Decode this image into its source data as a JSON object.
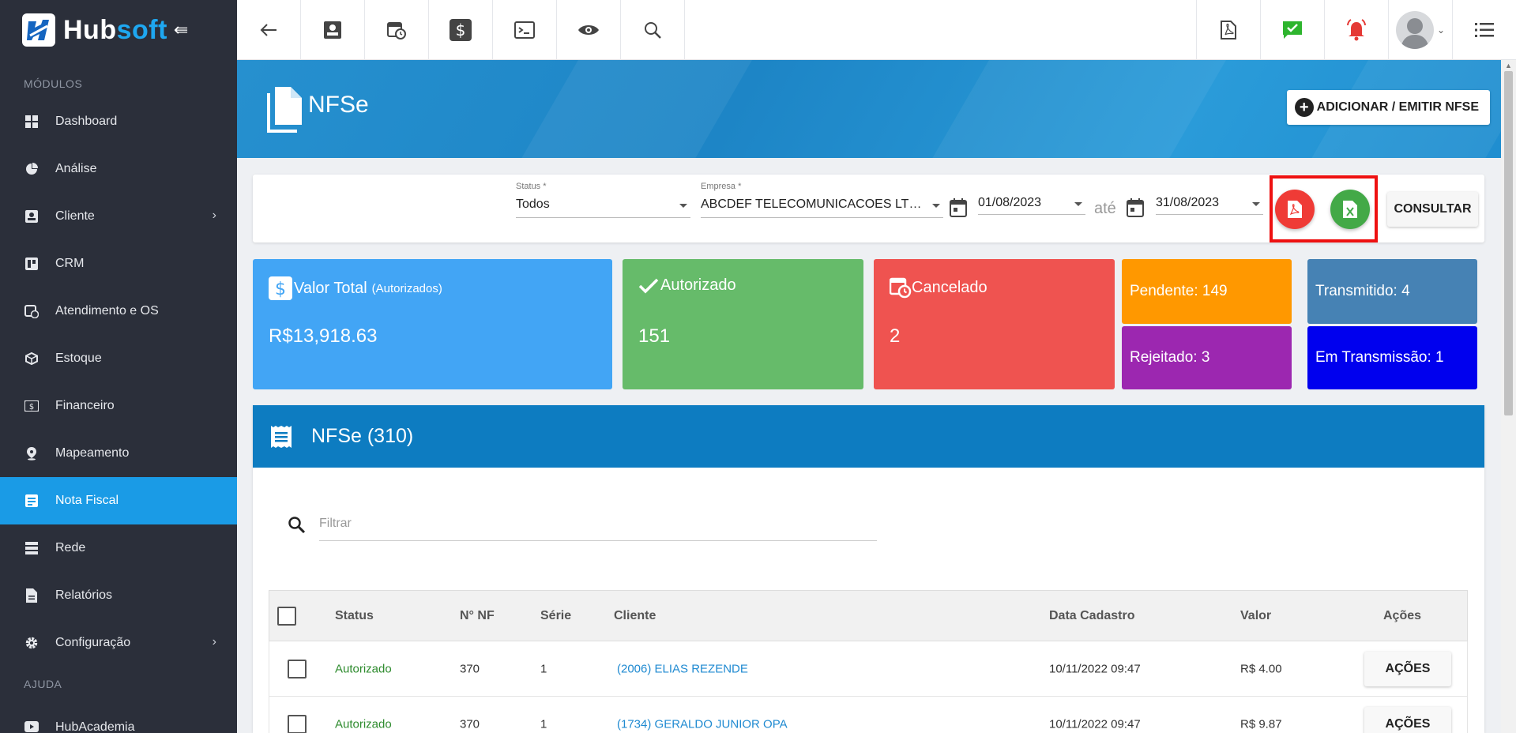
{
  "brand": {
    "name_part1": "Hub",
    "name_part2": "soft"
  },
  "sidebar": {
    "section_modules": "MÓDULOS",
    "items": [
      {
        "label": "Dashboard"
      },
      {
        "label": "Análise"
      },
      {
        "label": "Cliente"
      },
      {
        "label": "CRM"
      },
      {
        "label": "Atendimento e OS"
      },
      {
        "label": "Estoque"
      },
      {
        "label": "Financeiro"
      },
      {
        "label": "Mapeamento"
      },
      {
        "label": "Nota Fiscal"
      },
      {
        "label": "Rede"
      },
      {
        "label": "Relatórios"
      },
      {
        "label": "Configuração"
      }
    ],
    "section_help": "AJUDA",
    "help_items": [
      {
        "label": "HubAcademia"
      }
    ]
  },
  "page": {
    "title": "NFSe",
    "add_button": "ADICIONAR / EMITIR NFSE"
  },
  "filters": {
    "status_label": "Status *",
    "status_value": "Todos",
    "empresa_label": "Empresa *",
    "empresa_value": "ABCDEF TELECOMUNICACOES LTDA...",
    "date_from": "01/08/2023",
    "until": "até",
    "date_to": "31/08/2023",
    "consultar": "CONSULTAR"
  },
  "stats": {
    "total_title": "Valor Total",
    "total_sub": "(Autorizados)",
    "total_value": "R$13,918.63",
    "autorizado_title": "Autorizado",
    "autorizado_value": "151",
    "cancelado_title": "Cancelado",
    "cancelado_value": "2",
    "pendente": "Pendente: 149",
    "rejeitado": "Rejeitado: 3",
    "transmitido": "Transmitido: 4",
    "em_transmissao": "Em Transmissão: 1"
  },
  "list": {
    "title": "NFSe (310)",
    "filter_placeholder": "Filtrar",
    "columns": [
      "Status",
      "N° NF",
      "Série",
      "Cliente",
      "Data Cadastro",
      "Valor",
      "Ações"
    ],
    "rows": [
      {
        "status": "Autorizado",
        "nf": "370",
        "serie": "1",
        "cliente": "(2006) ELIAS REZENDE",
        "data": "10/11/2022 09:47",
        "valor": "R$ 4.00",
        "acoes": "AÇÕES"
      },
      {
        "status": "Autorizado",
        "nf": "370",
        "serie": "1",
        "cliente": "(1734) GERALDO JUNIOR OPA",
        "data": "10/11/2022 09:47",
        "valor": "R$ 9.87",
        "acoes": "AÇÕES"
      }
    ]
  },
  "colors": {
    "sidebar_bg": "#2b2f3a",
    "active": "#1a9be6",
    "valor_total": "#42a5f5",
    "autorizado": "#66bb6a",
    "cancelado": "#ef5350",
    "pendente": "#ff9800",
    "rejeitado": "#9c27b0",
    "transmitido": "#4682b4",
    "em_transmissao": "#0000ee",
    "highlight": "#ee1111"
  }
}
